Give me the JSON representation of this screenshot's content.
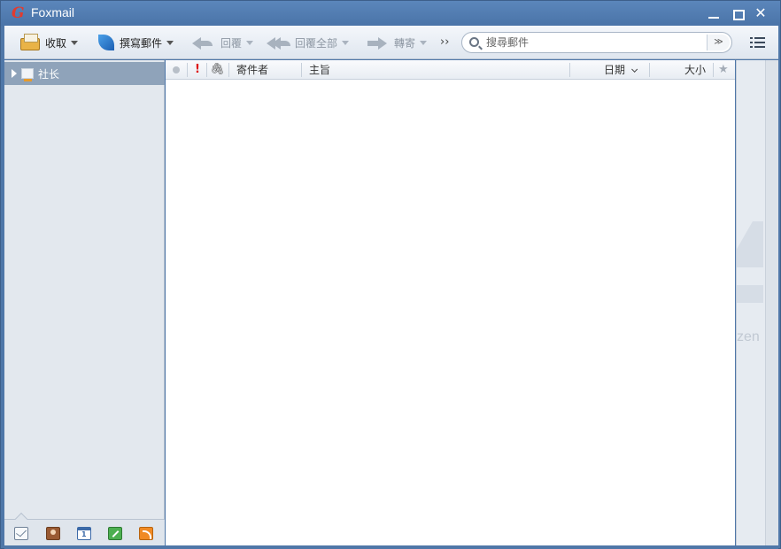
{
  "window": {
    "title": "Foxmail",
    "logo_letter": "G"
  },
  "toolbar": {
    "receive_label": "收取",
    "compose_label": "撰寫郵件",
    "reply_label": "回覆",
    "reply_all_label": "回覆全部",
    "forward_label": "轉寄",
    "more_label": "››"
  },
  "search": {
    "placeholder": "搜尋郵件",
    "dropdown_glyph": "≫"
  },
  "sidebar": {
    "account_name": "社长"
  },
  "mail_list": {
    "columns": {
      "sender": "寄件者",
      "subject": "主旨",
      "date": "日期",
      "size": "大小"
    },
    "priority_glyph": "!",
    "attach_glyph": "🖇",
    "star_glyph": "★",
    "rows": []
  },
  "right_pane": {
    "partial_text": "zen"
  }
}
